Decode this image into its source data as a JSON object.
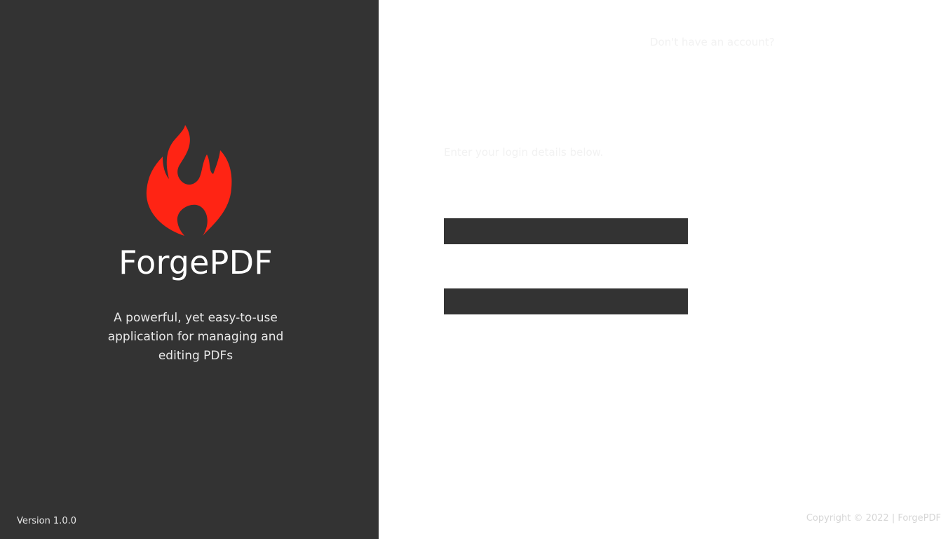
{
  "brand": {
    "name": "ForgePDF",
    "tagline": "A powerful, yet easy-to-use application for managing and editing PDFs",
    "logo_icon": "flame-icon",
    "logo_color": "#ff2414"
  },
  "footer": {
    "version": "Version 1.0.0",
    "copyright": "Copyright © 2022 | ForgePDF"
  },
  "auth": {
    "signup_prompt": "Don't have an account?",
    "login_hint": "Enter your login details below.",
    "username": {
      "value": "",
      "placeholder": ""
    },
    "password": {
      "value": "",
      "placeholder": ""
    }
  },
  "colors": {
    "left_panel": "#333333",
    "right_panel": "#ffffff",
    "accent": "#ff2414"
  }
}
